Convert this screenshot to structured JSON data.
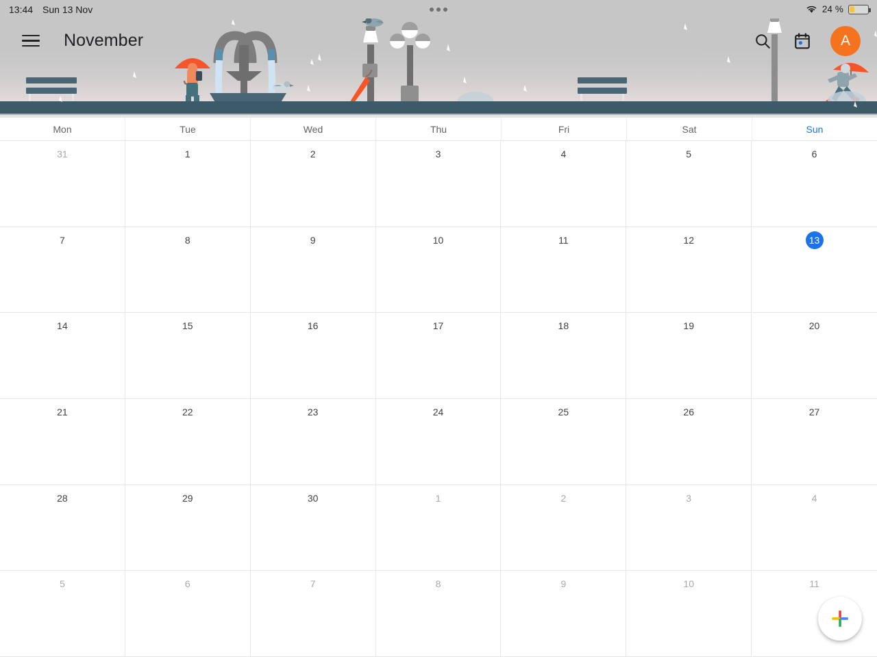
{
  "status_bar": {
    "time": "13:44",
    "date": "Sun 13 Nov",
    "wifi_icon": "wifi-icon",
    "battery_percent": "24 %",
    "battery_level": 24,
    "battery_saver_color": "#f5c63c",
    "overflow_dots_icon": "more-dots-icon"
  },
  "header": {
    "menu_icon": "hamburger-menu-icon",
    "title": "November",
    "search_icon": "search-icon",
    "today_calendar_icon": "calendar-today-icon",
    "avatar_initial": "A",
    "avatar_color": "#f4731c",
    "accent_color": "#1a73e8"
  },
  "banner": {
    "description": "rainy-park-illustration",
    "sky_color": "#c6c6c6",
    "ground_color": "#3d5a68",
    "umbrella_color": "#f4562a"
  },
  "weekdays": [
    {
      "label": "Mon",
      "is_today_column": false
    },
    {
      "label": "Tue",
      "is_today_column": false
    },
    {
      "label": "Wed",
      "is_today_column": false
    },
    {
      "label": "Thu",
      "is_today_column": false
    },
    {
      "label": "Fri",
      "is_today_column": false
    },
    {
      "label": "Sat",
      "is_today_column": false
    },
    {
      "label": "Sun",
      "is_today_column": true
    }
  ],
  "grid": {
    "days": [
      {
        "num": "31",
        "muted": true,
        "today": false
      },
      {
        "num": "1",
        "muted": false,
        "today": false
      },
      {
        "num": "2",
        "muted": false,
        "today": false
      },
      {
        "num": "3",
        "muted": false,
        "today": false
      },
      {
        "num": "4",
        "muted": false,
        "today": false
      },
      {
        "num": "5",
        "muted": false,
        "today": false
      },
      {
        "num": "6",
        "muted": false,
        "today": false
      },
      {
        "num": "7",
        "muted": false,
        "today": false
      },
      {
        "num": "8",
        "muted": false,
        "today": false
      },
      {
        "num": "9",
        "muted": false,
        "today": false
      },
      {
        "num": "10",
        "muted": false,
        "today": false
      },
      {
        "num": "11",
        "muted": false,
        "today": false
      },
      {
        "num": "12",
        "muted": false,
        "today": false
      },
      {
        "num": "13",
        "muted": false,
        "today": true
      },
      {
        "num": "14",
        "muted": false,
        "today": false
      },
      {
        "num": "15",
        "muted": false,
        "today": false
      },
      {
        "num": "16",
        "muted": false,
        "today": false
      },
      {
        "num": "17",
        "muted": false,
        "today": false
      },
      {
        "num": "18",
        "muted": false,
        "today": false
      },
      {
        "num": "19",
        "muted": false,
        "today": false
      },
      {
        "num": "20",
        "muted": false,
        "today": false
      },
      {
        "num": "21",
        "muted": false,
        "today": false
      },
      {
        "num": "22",
        "muted": false,
        "today": false
      },
      {
        "num": "23",
        "muted": false,
        "today": false
      },
      {
        "num": "24",
        "muted": false,
        "today": false
      },
      {
        "num": "25",
        "muted": false,
        "today": false
      },
      {
        "num": "26",
        "muted": false,
        "today": false
      },
      {
        "num": "27",
        "muted": false,
        "today": false
      },
      {
        "num": "28",
        "muted": false,
        "today": false
      },
      {
        "num": "29",
        "muted": false,
        "today": false
      },
      {
        "num": "30",
        "muted": false,
        "today": false
      },
      {
        "num": "1",
        "muted": true,
        "today": false
      },
      {
        "num": "2",
        "muted": true,
        "today": false
      },
      {
        "num": "3",
        "muted": true,
        "today": false
      },
      {
        "num": "4",
        "muted": true,
        "today": false
      },
      {
        "num": "5",
        "muted": true,
        "today": false
      },
      {
        "num": "6",
        "muted": true,
        "today": false
      },
      {
        "num": "7",
        "muted": true,
        "today": false
      },
      {
        "num": "8",
        "muted": true,
        "today": false
      },
      {
        "num": "9",
        "muted": true,
        "today": false
      },
      {
        "num": "10",
        "muted": true,
        "today": false
      },
      {
        "num": "11",
        "muted": true,
        "today": false
      }
    ]
  },
  "fab": {
    "icon": "plus-icon",
    "colors": {
      "red": "#ea4335",
      "yellow": "#fbbc04",
      "blue": "#4285f4",
      "green": "#34a853"
    }
  }
}
